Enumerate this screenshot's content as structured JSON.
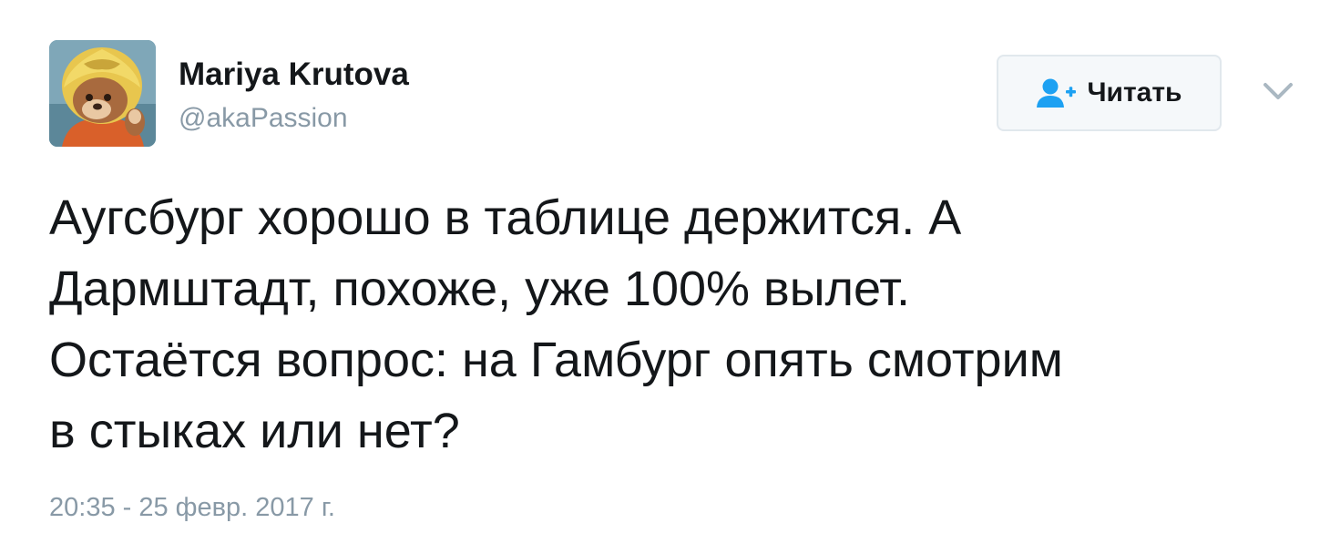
{
  "author": {
    "name": "Mariya Krutova",
    "handle": "@akaPassion",
    "avatar_icon": "avatar-cartoon-fox-astronaut"
  },
  "follow_button": {
    "label": "Читать",
    "icon": "follow-person-plus-icon",
    "accent_color": "#1da1f2"
  },
  "menu": {
    "icon": "chevron-down-icon"
  },
  "tweet": {
    "lines": [
      "Аугсбург хорошо в таблице держится. А",
      "Дармштадт, похоже, уже 100% вылет.",
      "Остаётся вопрос: на Гамбург опять смотрим",
      "в стыках или нет?"
    ],
    "timestamp": "20:35 - 25 февр. 2017 г."
  },
  "colors": {
    "text": "#14171a",
    "muted": "#8899a6",
    "border": "#e1e8ed"
  }
}
